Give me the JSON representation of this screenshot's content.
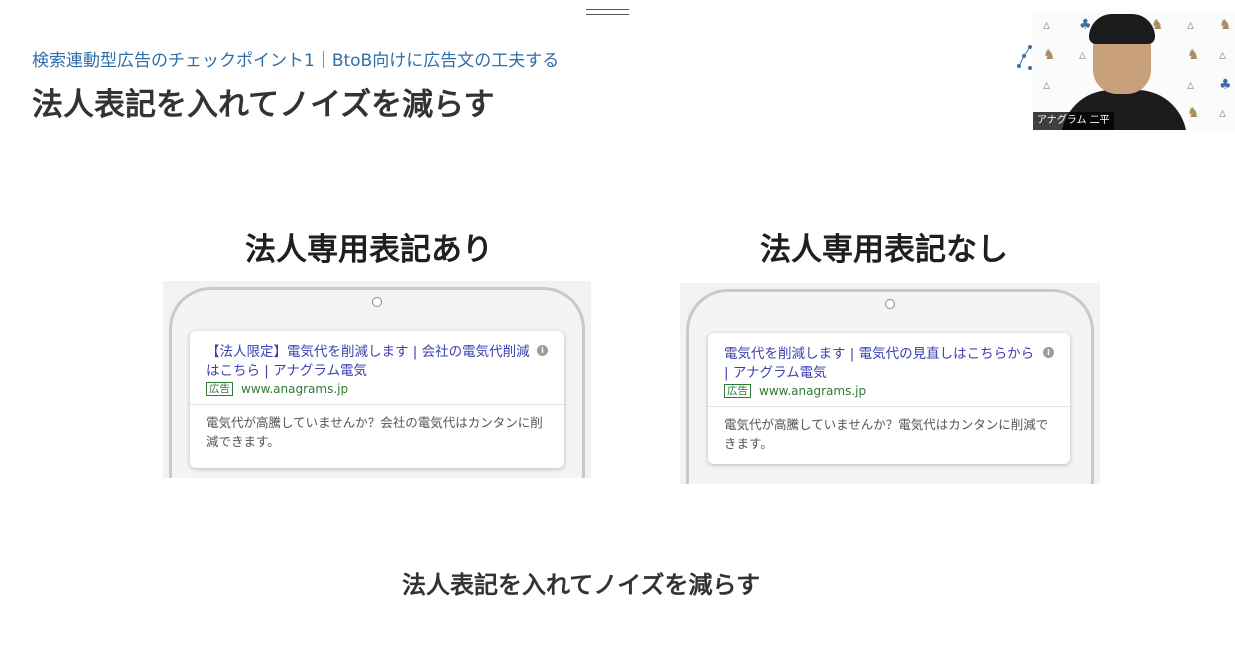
{
  "slide": {
    "subtitle": "検索連動型広告のチェックポイント1｜BtoB向けに広告文の工夫する",
    "title": "法人表記を入れてノイズを減らす",
    "caption": "法人表記を入れてノイズを減らす"
  },
  "video": {
    "participant_name": "アナグラム 二平"
  },
  "panels": [
    {
      "label": "法人専用表記あり",
      "ad": {
        "headline": "【法人限定】電気代を削減します | 会社の電気代削減はこちら | アナグラム電気",
        "badge": "広告",
        "url": "www.anagrams.jp",
        "description": "電気代が高騰していませんか？会社の電気代はカンタンに削減できます。",
        "info_icon": "i"
      }
    },
    {
      "label": "法人専用表記なし",
      "ad": {
        "headline": "電気代を削減します | 電気代の見直しはこちらから | アナグラム電気",
        "badge": "広告",
        "url": "www.anagrams.jp",
        "description": "電気代が高騰していませんか？電気代はカンタンに削減できます。",
        "info_icon": "i"
      }
    }
  ],
  "colors": {
    "subtitle": "#2f6fa8",
    "ad_headline": "#3b3fb1",
    "ad_url": "#2f7a37"
  }
}
